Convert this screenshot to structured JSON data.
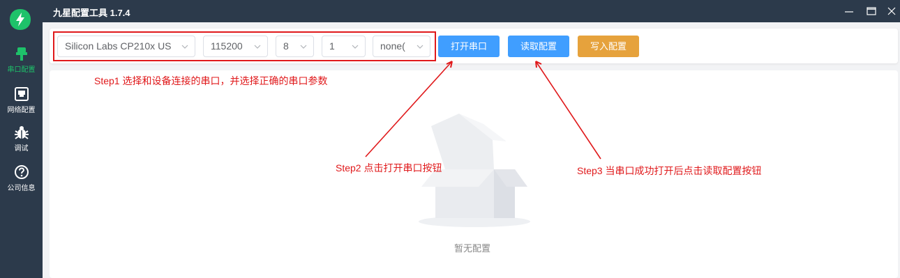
{
  "app": {
    "title": "九星配置工具 1.7.4"
  },
  "sidebar": {
    "items": [
      {
        "label": "串口配置",
        "icon": "serial-plug-icon",
        "active": true
      },
      {
        "label": "网络配置",
        "icon": "network-port-icon",
        "active": false
      },
      {
        "label": "调试",
        "icon": "bug-icon",
        "active": false
      },
      {
        "label": "公司信息",
        "icon": "question-circle-icon",
        "active": false
      }
    ]
  },
  "toolbar": {
    "port": "Silicon Labs CP210x US",
    "baud": "115200",
    "data_bits": "8",
    "stop_bits": "1",
    "parity": "none(",
    "open_label": "打开串口",
    "read_label": "读取配置",
    "write_label": "写入配置"
  },
  "empty": {
    "text": "暂无配置"
  },
  "annotations": {
    "step1": "Step1 选择和设备连接的串口，并选择正确的串口参数",
    "step2": "Step2 点击打开串口按钮",
    "step3": "Step3 当串口成功打开后点击读取配置按钮"
  },
  "colors": {
    "sidebar_bg": "#2c3a4b",
    "accent_green": "#1ec26a",
    "primary_blue": "#409eff",
    "warning_orange": "#e6a23c",
    "annotation_red": "#e0191b"
  }
}
